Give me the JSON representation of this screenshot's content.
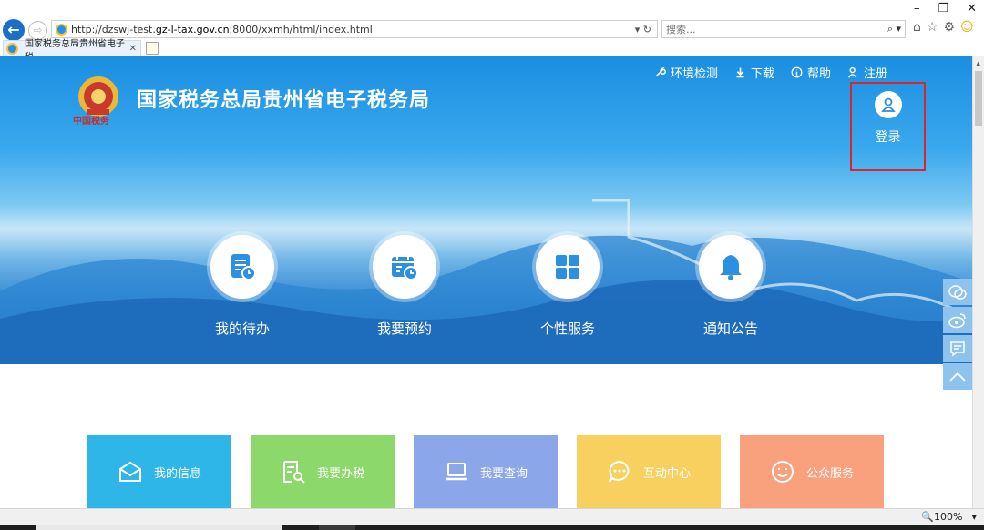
{
  "browser": {
    "window_controls": [
      "–",
      "❐",
      "✕"
    ],
    "url_prefix": "http://dzswj-test.",
    "url_host": "gz-l-tax.gov.cn",
    "url_suffix": ":8000/xxmh/html/index.html",
    "address_controls": "▾ ↻",
    "search_placeholder": "搜索...",
    "search_controls": "⌕ ▾",
    "tab_title": "国家税务总局贵州省电子税",
    "tab_close": "✕",
    "zoom": "🔍100%",
    "zoom_arrow": "▾"
  },
  "header": {
    "title": "国家税务总局贵州省电子税务局",
    "emblem_text": "中国税务",
    "links": [
      {
        "label": "环境检测",
        "icon": "wrench-icon"
      },
      {
        "label": "下载",
        "icon": "download-icon"
      },
      {
        "label": "帮助",
        "icon": "info-icon"
      },
      {
        "label": "注册",
        "icon": "user-register-icon"
      }
    ],
    "login_label": "登录"
  },
  "hero_items": [
    {
      "label": "我的待办",
      "icon": "todo-icon"
    },
    {
      "label": "我要预约",
      "icon": "calendar-icon"
    },
    {
      "label": "个性服务",
      "icon": "grid-icon"
    },
    {
      "label": "通知公告",
      "icon": "bell-icon"
    }
  ],
  "float_toolbar": [
    "wechat-icon",
    "weibo-icon",
    "message-icon",
    "back-to-top-icon"
  ],
  "cards": [
    {
      "label": "我的信息",
      "color": "#2fb6e8",
      "icon": "envelope-icon"
    },
    {
      "label": "我要办税",
      "color": "#8cd86a",
      "icon": "document-search-icon"
    },
    {
      "label": "我要查询",
      "color": "#8ca6ea",
      "icon": "laptop-icon"
    },
    {
      "label": "互动中心",
      "color": "#f7d060",
      "icon": "chat-icon"
    },
    {
      "label": "公众服务",
      "color": "#f9a07c",
      "icon": "smile-icon"
    }
  ],
  "colors": {
    "hero_blue": "#1a8ee0",
    "login_border": "#d8272c"
  }
}
